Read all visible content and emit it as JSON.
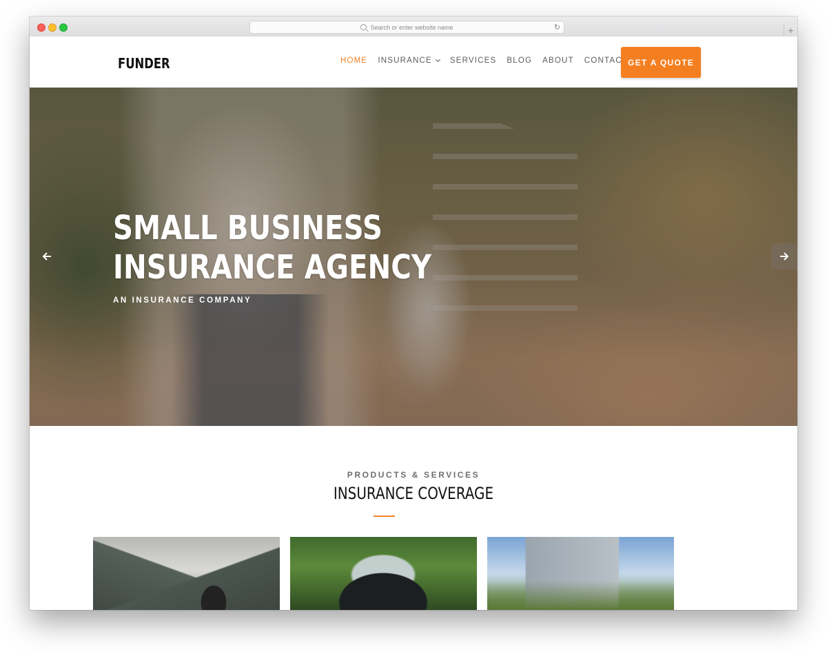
{
  "browser": {
    "url_placeholder": "Search or enter website name",
    "reload_icon": "reload-icon",
    "new_tab_label": "+"
  },
  "site": {
    "logo": "FUNDER",
    "nav": [
      {
        "label": "HOME",
        "active": true
      },
      {
        "label": "INSURANCE",
        "has_dropdown": true
      },
      {
        "label": "SERVICES"
      },
      {
        "label": "BLOG"
      },
      {
        "label": "ABOUT"
      },
      {
        "label": "CONTACT"
      }
    ],
    "cta": "GET A QUOTE",
    "accent_color": "#f47f20"
  },
  "hero": {
    "title_line1": "SMALL BUSINESS",
    "title_line2": "INSURANCE AGENCY",
    "subtitle": "AN INSURANCE COMPANY",
    "prev_icon": "arrow-left-icon",
    "next_icon": "arrow-right-icon"
  },
  "coverage": {
    "kicker": "PRODUCTS & SERVICES",
    "title": "INSURANCE COVERAGE"
  }
}
